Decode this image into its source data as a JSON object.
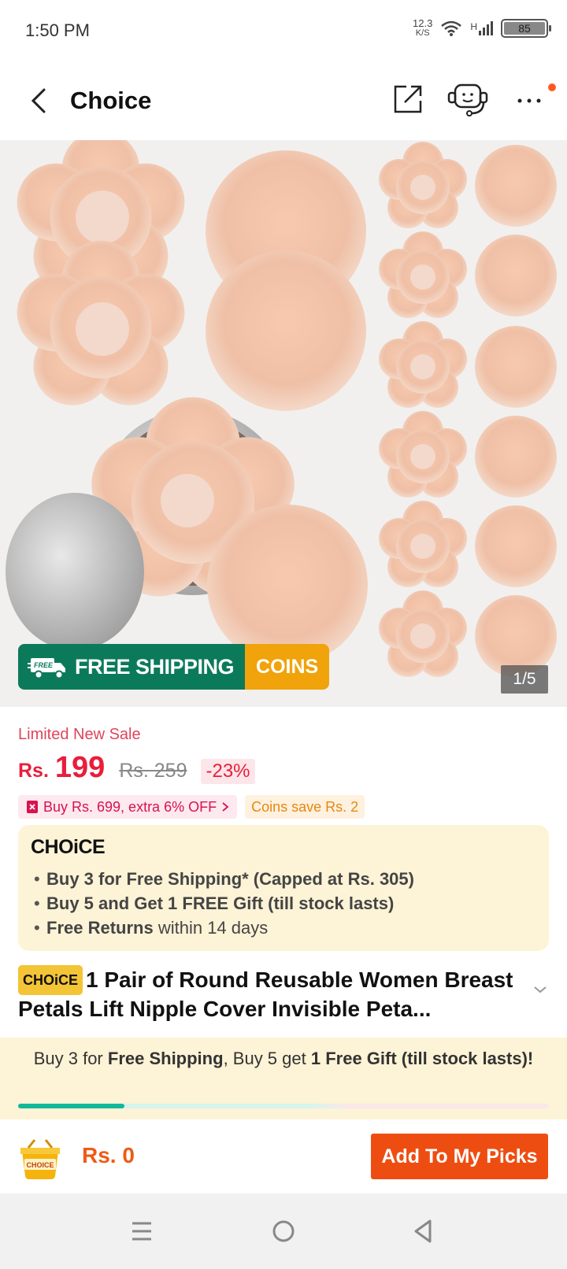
{
  "status_bar": {
    "time": "1:50 PM",
    "net_speed_value": "12.3",
    "net_speed_unit": "K/S",
    "network_type": "H",
    "battery": "85"
  },
  "header": {
    "title": "Choice"
  },
  "product_image": {
    "banner_free_tag": "FREE",
    "banner_free_shipping": "FREE SHIPPING",
    "banner_coins": "COINS",
    "page_indicator": "1/5"
  },
  "pricing": {
    "sale_label": "Limited New Sale",
    "currency": "Rs.",
    "price": "199",
    "old_price": "Rs. 259",
    "discount": "-23%",
    "promo": "Buy Rs. 699, extra 6% OFF",
    "coins_save": "Coins save Rs. 2"
  },
  "choice_box": {
    "logo": "CHOiCE",
    "benefits": [
      {
        "bold": "Buy 3 for  Free Shipping* (Capped at Rs. 305)",
        "rest": ""
      },
      {
        "bold": "Buy 5 and Get 1 FREE Gift (till stock lasts)",
        "rest": ""
      },
      {
        "bold": "Free Returns",
        "rest": " within 14 days"
      }
    ]
  },
  "product": {
    "tag": "CHOiCE",
    "title": "1 Pair of Round Reusable Women Breast Petals Lift Nipple Cover Invisible Peta..."
  },
  "gift_bar": {
    "part1": "Buy 3 for ",
    "part2": "Free Shipping",
    "part3": ", Buy 5 get ",
    "part4": "1 Free Gift (till stock lasts)!",
    "progress": 0.2
  },
  "action_bar": {
    "cart_label": "CHOICE",
    "cart_total": "Rs. 0",
    "add_button": "Add To My Picks"
  },
  "colors": {
    "accent": "#ee4d12",
    "price_red": "#e81e3b",
    "free_green": "#0b7a5a",
    "coins_orange": "#f0a30a",
    "choice_bg": "#fdf3d6"
  }
}
